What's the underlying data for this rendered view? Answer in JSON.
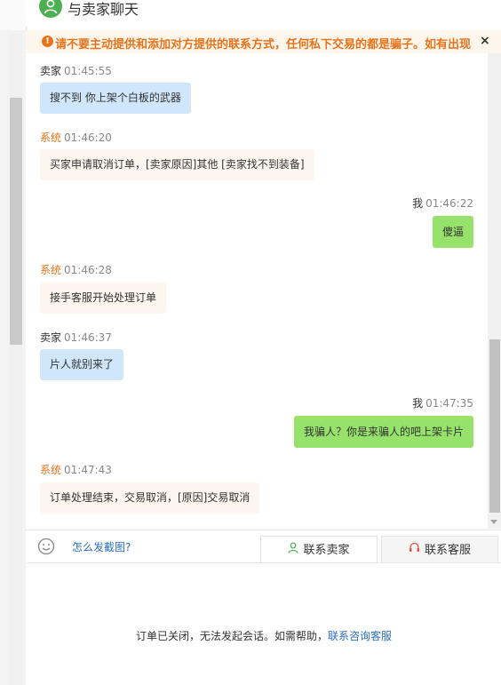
{
  "header": {
    "title": "与卖家聊天",
    "avatar_icon": "user-icon"
  },
  "notice": {
    "text": "请不要主动提供和添加对方提供的联系方式，任何私下交易的都是骗子。如有出现",
    "icon": "warning-icon",
    "close": "×"
  },
  "messages": [
    {
      "role": "seller",
      "who": "卖家",
      "time": "01:45:55",
      "text": "搜不到   你上架个白板的武器"
    },
    {
      "role": "system",
      "who": "系统",
      "time": "01:46:20",
      "text": "买家申请取消订单，[卖家原因]其他 [卖家找不到装备]"
    },
    {
      "role": "me",
      "who": "我",
      "time": "01:46:22",
      "text": "傻逼"
    },
    {
      "role": "system",
      "who": "系统",
      "time": "01:46:28",
      "text": "接手客服开始处理订单"
    },
    {
      "role": "seller",
      "who": "卖家",
      "time": "01:46:37",
      "text": "片人就别来了"
    },
    {
      "role": "me",
      "who": "我",
      "time": "01:47:35",
      "text": "我骗人？你是来骗人的吧上架卡片"
    },
    {
      "role": "system",
      "who": "系统",
      "time": "01:47:43",
      "text": "订单处理结束，交易取消，[原因]交易取消"
    }
  ],
  "toolbar": {
    "emoji_icon": "smile-icon",
    "help_link": "怎么发截图?",
    "tab_seller": "联系卖家",
    "tab_service": "联系客服"
  },
  "footer": {
    "closed_text": "订单已关闭，无法发起会话。如需帮助，",
    "closed_link": "联系咨询客服"
  },
  "colors": {
    "system": "#e8731a",
    "seller_bubble": "#cfe6fb",
    "me_bubble": "#96e26a",
    "link": "#2a6ebb"
  }
}
